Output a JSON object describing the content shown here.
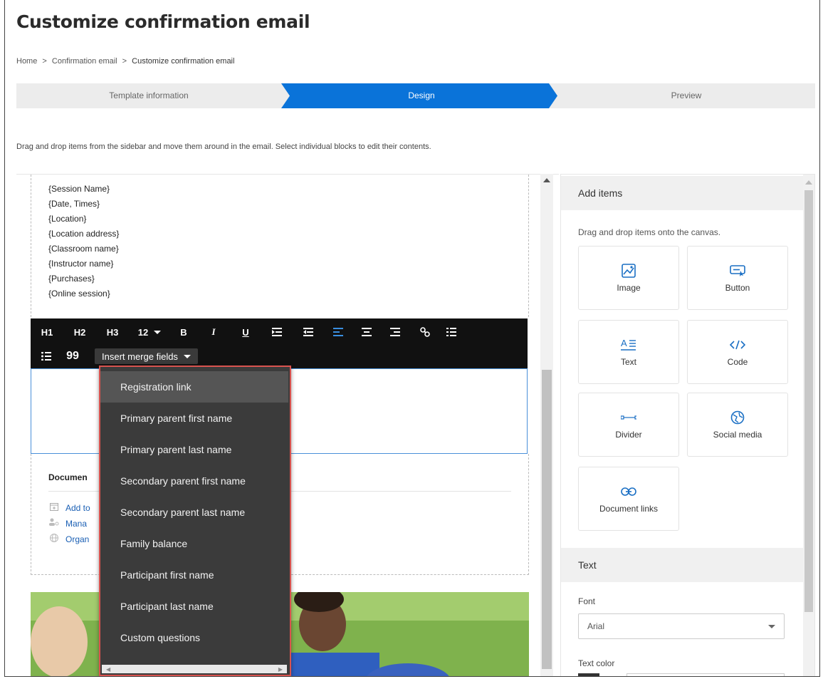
{
  "page": {
    "title": "Customize confirmation email"
  },
  "breadcrumb": {
    "home": "Home",
    "separator": ">",
    "parent": "Confirmation email",
    "current": "Customize confirmation email"
  },
  "wizard": {
    "steps": [
      {
        "label": "Template information",
        "state": "completed"
      },
      {
        "label": "Design",
        "state": "active"
      },
      {
        "label": "Preview",
        "state": "pending"
      }
    ],
    "active_color": "#0a73d9"
  },
  "instructions": "Drag and drop items from the sidebar and move them around in the email. Select individual blocks to edit their contents.",
  "canvas": {
    "session_fields": [
      "{Session Name}",
      "{Date, Times}",
      "{Location}",
      "{Location address}",
      "{Classroom name}",
      "{Instructor name}",
      "{Purchases}",
      "{Online session}"
    ],
    "toolbar": {
      "h1": "H1",
      "h2": "H2",
      "h3": "H3",
      "font_size": "12",
      "bold": "B",
      "italic": "I",
      "underline": "U",
      "quote": "99",
      "insert_merge_fields": "Insert merge fields"
    },
    "documents": {
      "title_visible": "Documen",
      "links_visible": [
        "Add to",
        "Mana",
        "Organ"
      ]
    }
  },
  "merge_menu": {
    "items": [
      "Registration link",
      "Primary parent first name",
      "Primary parent last name",
      "Secondary parent first name",
      "Secondary parent last name",
      "Family balance",
      "Participant first name",
      "Participant last name",
      "Custom questions"
    ],
    "highlight_color": "#d9534f"
  },
  "sidebar": {
    "add_items": {
      "header": "Add items",
      "hint": "Drag and drop items onto the canvas.",
      "tiles": [
        {
          "label": "Image",
          "icon": "image-icon"
        },
        {
          "label": "Button",
          "icon": "button-icon"
        },
        {
          "label": "Text",
          "icon": "text-icon"
        },
        {
          "label": "Code",
          "icon": "code-icon"
        },
        {
          "label": "Divider",
          "icon": "divider-icon"
        },
        {
          "label": "Social media",
          "icon": "globe-icon"
        },
        {
          "label": "Document links",
          "icon": "link-icon"
        }
      ]
    },
    "text_section": {
      "header": "Text",
      "font_label": "Font",
      "font_value": "Arial",
      "text_color_label": "Text color"
    },
    "icon_color": "#1a6fc4"
  }
}
